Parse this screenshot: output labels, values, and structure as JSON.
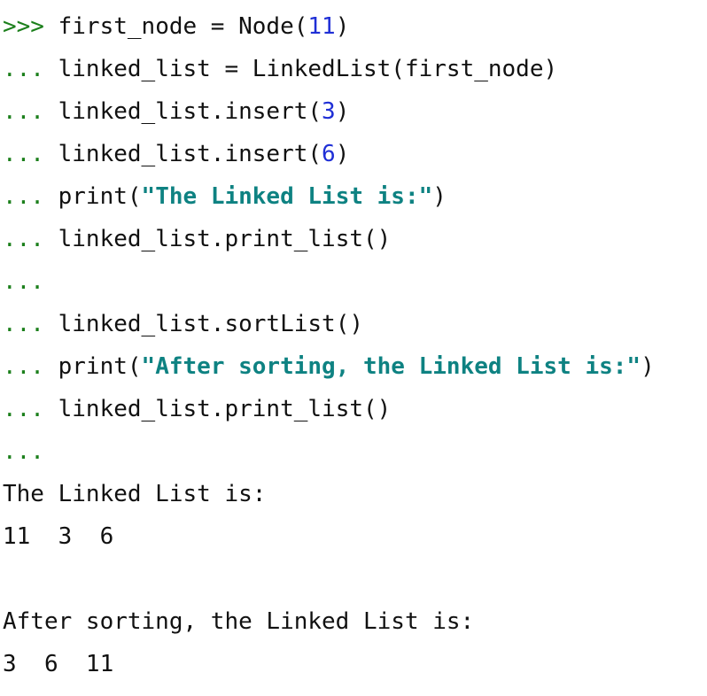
{
  "console": {
    "lines": [
      {
        "type": "code",
        "prompt": ">>>",
        "tokens": [
          {
            "t": "plain",
            "v": "first_node = Node("
          },
          {
            "t": "num",
            "v": "11"
          },
          {
            "t": "plain",
            "v": ")"
          }
        ]
      },
      {
        "type": "code",
        "prompt": "...",
        "tokens": [
          {
            "t": "plain",
            "v": "linked_list = LinkedList(first_node)"
          }
        ]
      },
      {
        "type": "code",
        "prompt": "...",
        "tokens": [
          {
            "t": "plain",
            "v": "linked_list.insert("
          },
          {
            "t": "num",
            "v": "3"
          },
          {
            "t": "plain",
            "v": ")"
          }
        ]
      },
      {
        "type": "code",
        "prompt": "...",
        "tokens": [
          {
            "t": "plain",
            "v": "linked_list.insert("
          },
          {
            "t": "num",
            "v": "6"
          },
          {
            "t": "plain",
            "v": ")"
          }
        ]
      },
      {
        "type": "code",
        "prompt": "...",
        "tokens": [
          {
            "t": "plain",
            "v": "print("
          },
          {
            "t": "str",
            "v": "\"The Linked List is:\""
          },
          {
            "t": "plain",
            "v": ")"
          }
        ]
      },
      {
        "type": "code",
        "prompt": "...",
        "tokens": [
          {
            "t": "plain",
            "v": "linked_list.print_list()"
          }
        ]
      },
      {
        "type": "code",
        "prompt": "...",
        "tokens": []
      },
      {
        "type": "code",
        "prompt": "...",
        "tokens": [
          {
            "t": "plain",
            "v": "linked_list.sortList()"
          }
        ]
      },
      {
        "type": "code",
        "prompt": "...",
        "tokens": [
          {
            "t": "plain",
            "v": "print("
          },
          {
            "t": "str",
            "v": "\"After sorting, the Linked List is:\""
          },
          {
            "t": "plain",
            "v": ")"
          }
        ]
      },
      {
        "type": "code",
        "prompt": "...",
        "tokens": [
          {
            "t": "plain",
            "v": "linked_list.print_list()"
          }
        ]
      },
      {
        "type": "code",
        "prompt": "...",
        "tokens": []
      },
      {
        "type": "output",
        "text": "The Linked List is:"
      },
      {
        "type": "output",
        "text": "11  3  6"
      },
      {
        "type": "output",
        "text": ""
      },
      {
        "type": "output",
        "text": "After sorting, the Linked List is:"
      },
      {
        "type": "output",
        "text": "3  6  11"
      }
    ]
  },
  "colors": {
    "prompt": "#1b7f1b",
    "number": "#1f2fd6",
    "string": "#0e8282",
    "text": "#111111",
    "background": "#ffffff"
  }
}
